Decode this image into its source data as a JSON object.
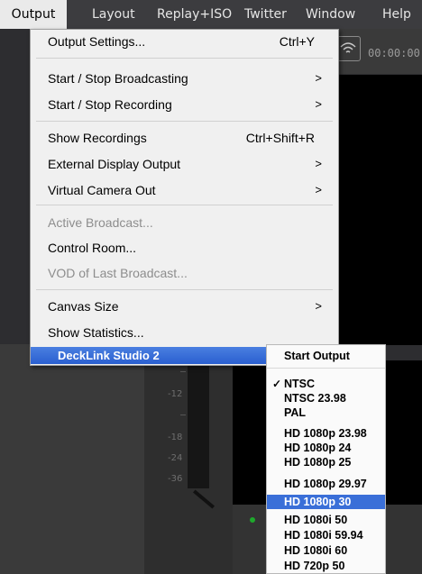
{
  "menubar": {
    "items": [
      {
        "label": "Output",
        "active": true
      },
      {
        "label": "Layout"
      },
      {
        "label": "Replay+ISO"
      },
      {
        "label": "Twitter"
      },
      {
        "label": "Window"
      },
      {
        "label": "Help"
      }
    ]
  },
  "background": {
    "timer": "00:00:00",
    "db_labels": [
      "-12",
      "-18",
      "-24",
      "-36"
    ]
  },
  "output_menu": {
    "output_settings": {
      "label": "Output Settings...",
      "shortcut": "Ctrl+Y"
    },
    "start_stop_broadcasting": {
      "label": "Start / Stop Broadcasting",
      "arrow": ">"
    },
    "start_stop_recording": {
      "label": "Start / Stop Recording",
      "arrow": ">"
    },
    "show_recordings": {
      "label": "Show Recordings",
      "shortcut": "Ctrl+Shift+R"
    },
    "external_display_output": {
      "label": "External Display Output",
      "arrow": ">"
    },
    "virtual_camera_out": {
      "label": "Virtual Camera Out",
      "arrow": ">"
    },
    "active_broadcast": {
      "label": "Active Broadcast..."
    },
    "control_room": {
      "label": "Control Room..."
    },
    "vod_last_broadcast": {
      "label": "VOD of Last Broadcast..."
    },
    "canvas_size": {
      "label": "Canvas Size",
      "arrow": ">"
    },
    "show_statistics": {
      "label": "Show Statistics..."
    },
    "decklink": {
      "label": "DeckLink Studio 2",
      "arrow": "▶"
    }
  },
  "decklink_menu": {
    "start_output": "Start Output",
    "check_mark": "✓",
    "formats": [
      "NTSC",
      "NTSC 23.98",
      "PAL",
      "HD 1080p 23.98",
      "HD 1080p 24",
      "HD 1080p 25",
      "HD 1080p 29.97",
      "HD 1080p 30",
      "HD 1080i 50",
      "HD 1080i 59.94",
      "HD 1080i 60",
      "HD 720p 50"
    ],
    "checked": "NTSC",
    "selected": "HD 1080p 30"
  },
  "colors": {
    "highlight": "#2a5fd0",
    "menubar_bg": "#3c3c3f",
    "meter_dot": "#1ea82c"
  },
  "icons": [
    "wifi-broadcast-icon",
    "submenu-arrow-icon",
    "check-icon"
  ]
}
